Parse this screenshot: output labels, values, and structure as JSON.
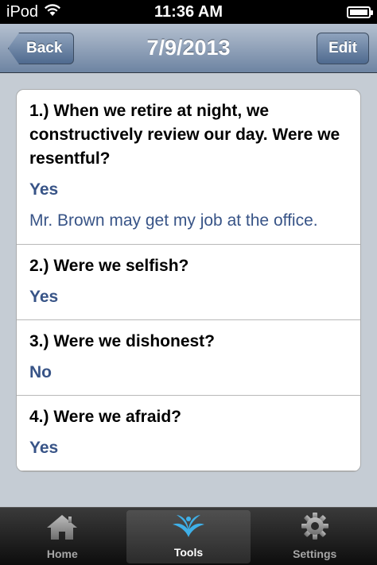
{
  "status_bar": {
    "carrier": "iPod",
    "time": "11:36 AM"
  },
  "nav": {
    "back_label": "Back",
    "title": "7/9/2013",
    "edit_label": "Edit"
  },
  "questions": [
    {
      "question": "1.) When we retire at night, we constructively review our day. Were we resentful?",
      "answer": "Yes",
      "note": "Mr. Brown may get my job at the office."
    },
    {
      "question": "2.) Were we selfish?",
      "answer": "Yes"
    },
    {
      "question": "3.) Were we dishonest?",
      "answer": "No"
    },
    {
      "question": "4.) Were we afraid?",
      "answer": "Yes"
    }
  ],
  "tabs": [
    {
      "label": "Home",
      "icon": "home-icon",
      "active": false
    },
    {
      "label": "Tools",
      "icon": "tools-icon",
      "active": true
    },
    {
      "label": "Settings",
      "icon": "gear-icon",
      "active": false
    }
  ],
  "colors": {
    "answer_text": "#385487",
    "nav_gradient_top": "#b5c1d0",
    "nav_gradient_bottom": "#6d84a2",
    "tools_icon": "#3fb0e8"
  }
}
